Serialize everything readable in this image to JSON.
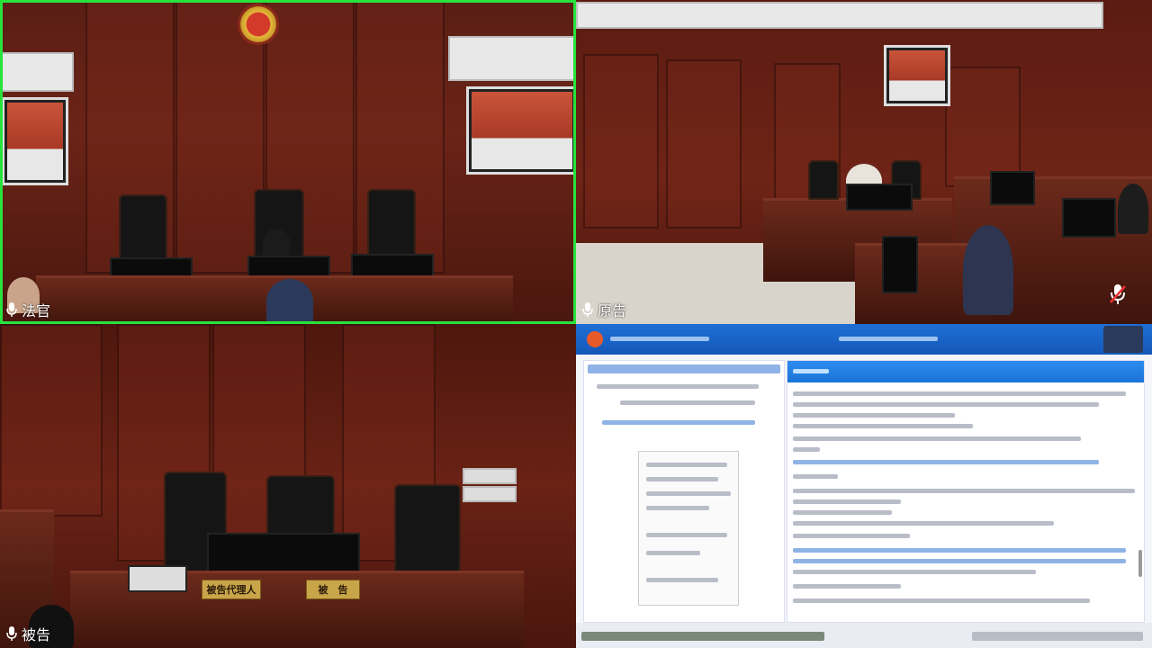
{
  "meeting": {
    "tiles": [
      {
        "label": "法官",
        "active": true
      },
      {
        "label": "原告",
        "active": false
      },
      {
        "label": "被告",
        "active": false
      },
      {
        "label": "",
        "shared_screen": true
      }
    ]
  },
  "nameplates": {
    "agent": "被告代理人",
    "defendant": "被　告"
  },
  "colors": {
    "active_border": "#27e33c",
    "wood": "#5a1e14",
    "doc_header": "#1f6fd6"
  },
  "icons": [
    "mic-icon",
    "mic-muted-icon",
    "national-emblem-icon"
  ]
}
